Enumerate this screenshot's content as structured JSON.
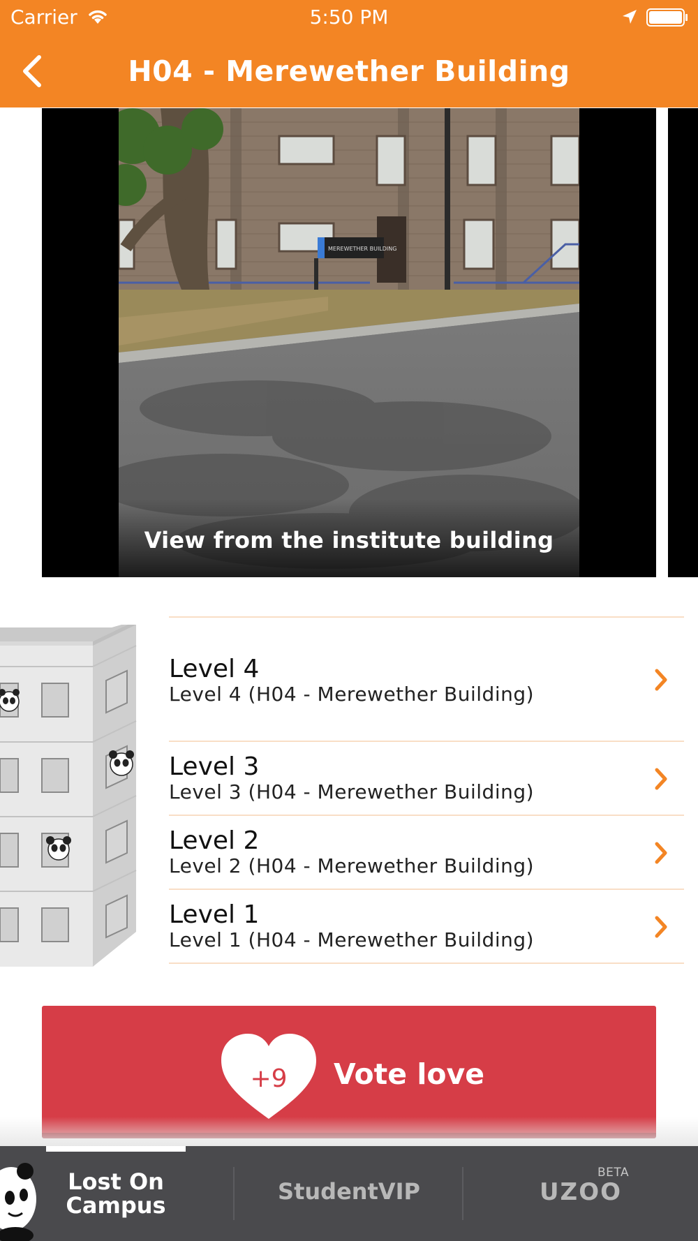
{
  "status_bar": {
    "carrier": "Carrier",
    "time": "5:50 PM",
    "wifi_icon": "wifi-icon",
    "location_icon": "location-arrow-icon",
    "battery_icon": "battery-full-icon"
  },
  "nav": {
    "title": "H04 - Merewether Building",
    "back_icon": "chevron-left-icon"
  },
  "photo": {
    "caption": "View from the institute building",
    "sign_text": "MEREWETHER BUILDING"
  },
  "levels": [
    {
      "title": "Level 4",
      "subtitle": "Level 4 (H04 - Merewether Building)"
    },
    {
      "title": "Level 3",
      "subtitle": "Level 3 (H04 - Merewether Building)"
    },
    {
      "title": "Level 2",
      "subtitle": "Level 2 (H04 - Merewether Building)"
    },
    {
      "title": "Level 1",
      "subtitle": "Level 1 (H04 - Merewether Building)"
    }
  ],
  "vote": {
    "count": "+9",
    "label": "Vote love"
  },
  "tabs": [
    {
      "label_line1": "Lost On",
      "label_line2": "Campus",
      "active": true
    },
    {
      "label": "StudentVIP",
      "active": false
    },
    {
      "label": "UZOO",
      "badge": "BETA",
      "active": false
    }
  ],
  "colors": {
    "brand_orange": "#f38524",
    "vote_red": "#d63d47",
    "tabbar_bg": "#4a4a4d",
    "separator": "#f9dec6"
  }
}
